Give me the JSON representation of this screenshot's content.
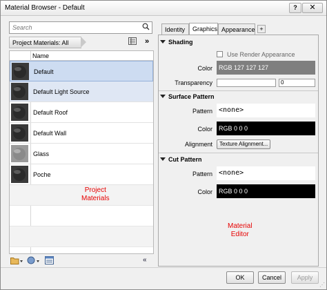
{
  "window": {
    "title": "Material Browser - Default",
    "help_label": "?",
    "close_label": "✕"
  },
  "left": {
    "search": {
      "placeholder": "Search"
    },
    "library_label": "Project Materials: All",
    "view_icon": "list-view-icon",
    "collapse_icon": "double-chevron-right-icon",
    "column_header": "Name",
    "materials": [
      {
        "name": "Default",
        "selected": true
      },
      {
        "name": "Default Light Source",
        "selected": false
      },
      {
        "name": "Default Roof",
        "selected": false
      },
      {
        "name": "Default Wall",
        "selected": false
      },
      {
        "name": "Glass",
        "selected": false
      },
      {
        "name": "Poche",
        "selected": false
      }
    ],
    "annotation": "Project\nMaterials"
  },
  "right": {
    "tabs": [
      {
        "label": "Identity",
        "active": false
      },
      {
        "label": "Graphics",
        "active": true
      },
      {
        "label": "Appearance",
        "active": false
      }
    ],
    "add_tab_label": "+",
    "shading": {
      "header": "Shading",
      "use_render_label": "Use Render Appearance",
      "color_label": "Color",
      "color_value": "RGB 127 127 127",
      "transparency_label": "Transparency",
      "transparency_value": "0"
    },
    "surface_pattern": {
      "header": "Surface Pattern",
      "pattern_label": "Pattern",
      "pattern_value": "<none>",
      "color_label": "Color",
      "color_value": "RGB 0 0 0",
      "alignment_label": "Alignment",
      "alignment_button": "Texture Alignment..."
    },
    "cut_pattern": {
      "header": "Cut Pattern",
      "pattern_label": "Pattern",
      "pattern_value": "<none>",
      "color_label": "Color",
      "color_value": "RGB 0 0 0"
    },
    "annotation": "Material\nEditor"
  },
  "footer": {
    "ok": "OK",
    "cancel": "Cancel",
    "apply": "Apply"
  },
  "colors": {
    "selection": "#cddcf1",
    "annotation": "#e60000",
    "grey_swatch": "#7f7f7f"
  }
}
